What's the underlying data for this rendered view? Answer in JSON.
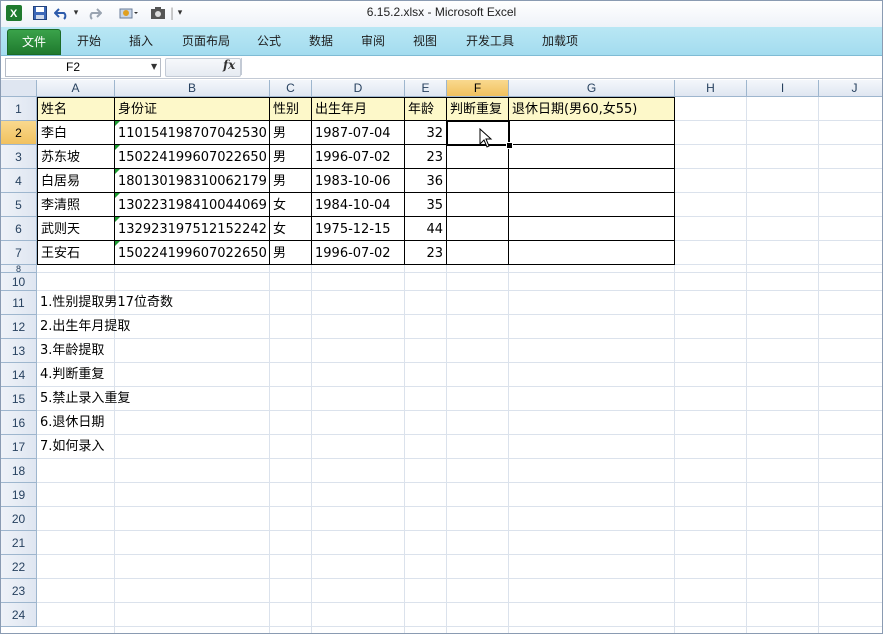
{
  "window": {
    "title": "6.15.2.xlsx  -  Microsoft Excel"
  },
  "quick_access": {
    "excel_icon": "X",
    "undo_arrow": "▾",
    "separator": "|",
    "more": "▾"
  },
  "ribbon": {
    "tabs": [
      "文件",
      "开始",
      "插入",
      "页面布局",
      "公式",
      "数据",
      "审阅",
      "视图",
      "开发工具",
      "加载项"
    ]
  },
  "formula_bar": {
    "name_box": "F2",
    "fx_label": "fx",
    "value": ""
  },
  "columns": [
    "A",
    "B",
    "C",
    "D",
    "E",
    "F",
    "G",
    "H",
    "I",
    "J"
  ],
  "selected_column": "F",
  "rows": [
    "1",
    "2",
    "3",
    "4",
    "5",
    "6",
    "7",
    "8",
    "10",
    "11",
    "12",
    "13",
    "14",
    "15",
    "16",
    "17",
    "18",
    "19",
    "20",
    "21",
    "22",
    "23",
    "24"
  ],
  "selected_row": "2",
  "table": {
    "headers": [
      "姓名",
      "身份证",
      "性别",
      "出生年月",
      "年龄",
      "判断重复",
      "退休日期(男60,女55)"
    ],
    "records": [
      [
        "李白",
        "110154198707042530",
        "男",
        "1987-07-04",
        "32",
        "",
        ""
      ],
      [
        "苏东坡",
        "150224199607022650",
        "男",
        "1996-07-02",
        "23",
        "",
        ""
      ],
      [
        "白居易",
        "180130198310062179",
        "男",
        "1983-10-06",
        "36",
        "",
        ""
      ],
      [
        "李清照",
        "130223198410044069",
        "女",
        "1984-10-04",
        "35",
        "",
        ""
      ],
      [
        "武则天",
        "132923197512152242",
        "女",
        "1975-12-15",
        "44",
        "",
        ""
      ],
      [
        "王安石",
        "150224199607022650",
        "男",
        "1996-07-02",
        "23",
        "",
        ""
      ]
    ]
  },
  "notes": [
    "1.性别提取男17位奇数",
    "2.出生年月提取",
    "3.年龄提取",
    "4.判断重复",
    "5.禁止录入重复",
    "6.退休日期",
    "7.如何录入"
  ],
  "colors": {
    "header_fill": "#fdf8c9",
    "file_tab": "#2a8f3c",
    "ribbon": "#b0e2f2",
    "selected_header": "#f5cd73"
  }
}
